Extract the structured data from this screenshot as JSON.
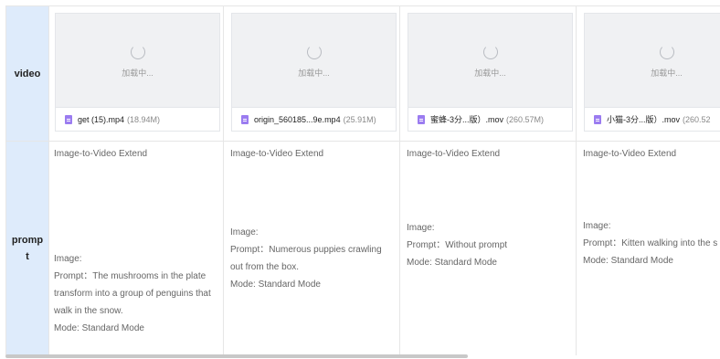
{
  "rows": {
    "video_label": "video",
    "prompt_label_1": "promp",
    "prompt_label_2": "t"
  },
  "videos": [
    {
      "loading": "加载中...",
      "name": "get (15).mp4",
      "size": "(18.94M)"
    },
    {
      "loading": "加载中...",
      "name": "origin_560185...9e.mp4",
      "size": "(25.91M)"
    },
    {
      "loading": "加载中...",
      "name": "蜜蜂-3分...版）.mov",
      "size": "(260.57M)"
    },
    {
      "loading": "加载中...",
      "name": "小猫-3分...版）.mov",
      "size": "(260.52"
    }
  ],
  "prompts": [
    {
      "title": "Image-to-Video Extend",
      "lines": [
        "Image:",
        "Prompt：The mushrooms in the plate",
        "transform into a group of penguins that",
        "walk in the snow.",
        "Mode: Standard Mode"
      ]
    },
    {
      "title": "Image-to-Video Extend",
      "lines": [
        "Image:",
        "Prompt：Numerous puppies crawling",
        "out from the box.",
        "Mode: Standard Mode"
      ]
    },
    {
      "title": "Image-to-Video Extend",
      "lines": [
        "Image:",
        "Prompt：Without prompt",
        "Mode: Standard Mode"
      ]
    },
    {
      "title": "Image-to-Video Extend",
      "lines": [
        "Image:",
        "Prompt：Kitten walking into the s",
        "Mode: Standard Mode"
      ]
    }
  ],
  "icons": {
    "spinner": "loading-spinner-icon",
    "file": "video-file-icon"
  },
  "colors": {
    "header_bg": "#deebfb",
    "file_icon": "#9b7cf0"
  }
}
